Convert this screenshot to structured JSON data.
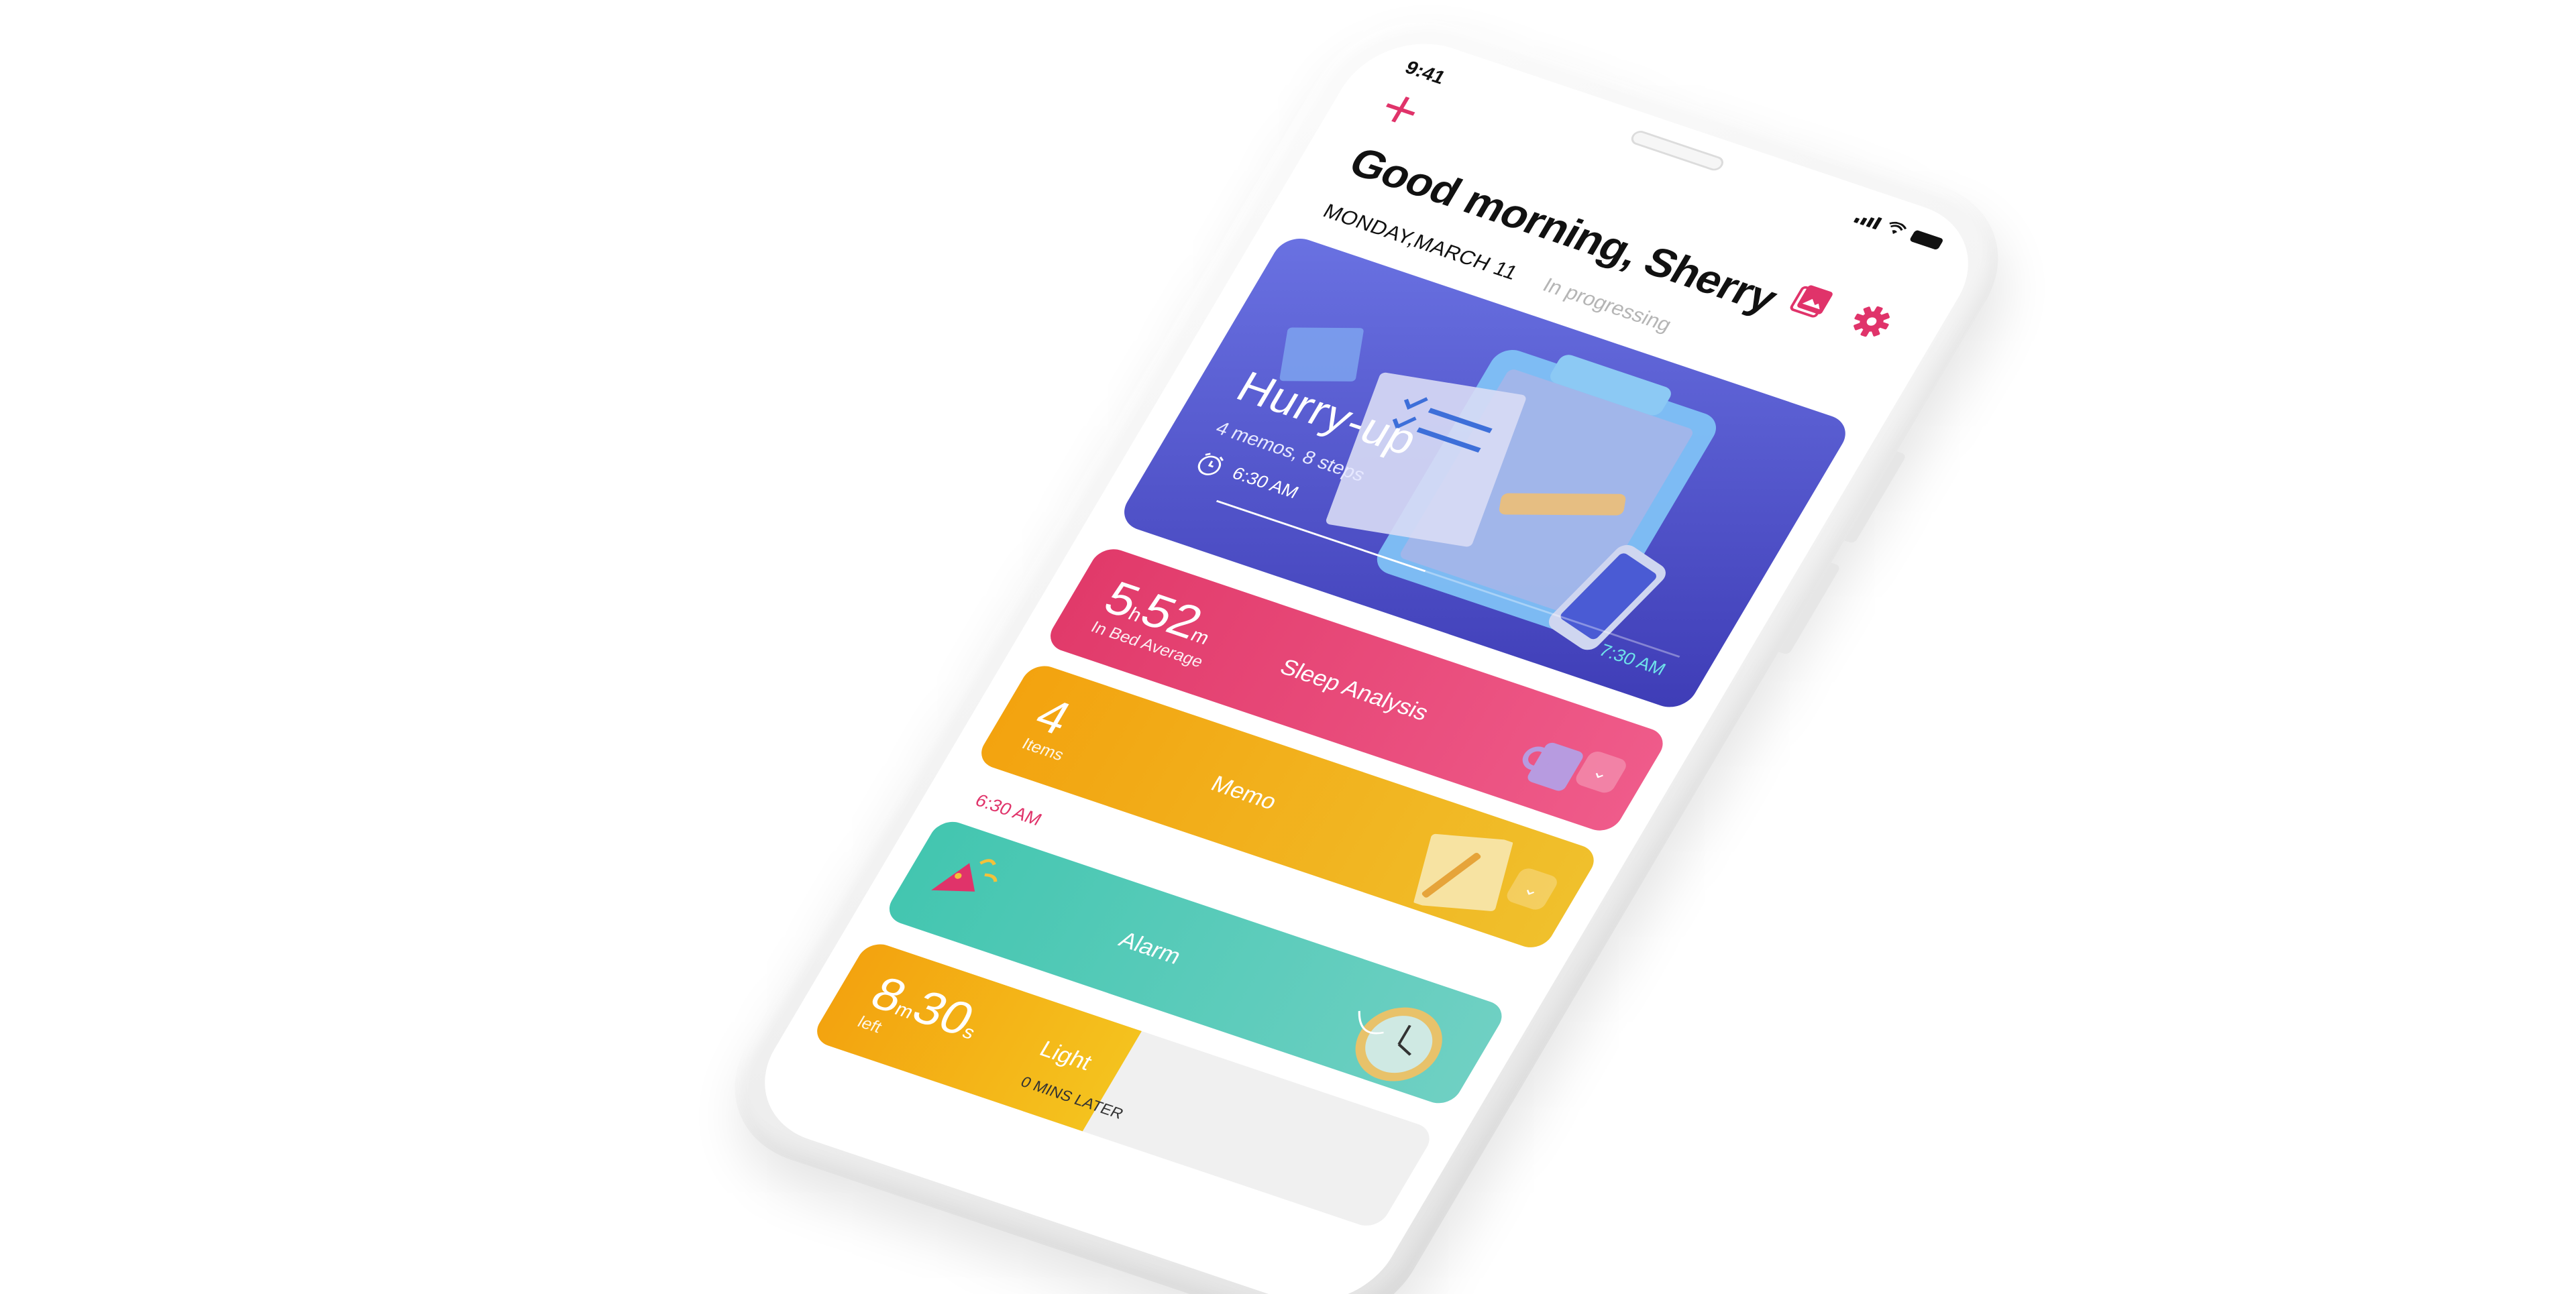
{
  "status_bar": {
    "time": "9:41"
  },
  "header": {
    "greeting": "Good morning,  Sherry",
    "date": "MONDAY,MARCH 11",
    "status": "In progressing",
    "icons": [
      "plus-icon",
      "gallery-icon",
      "gear-icon"
    ]
  },
  "hero": {
    "title": "Hurry-up",
    "subtitle": "4 memos, 8 steps",
    "start_time": "6:30 AM",
    "end_time": "7:30 AM",
    "progress": 0.45
  },
  "cards": {
    "sleep": {
      "hours": "5",
      "hours_unit": "h",
      "minutes": "52",
      "minutes_unit": "m",
      "caption": "In Bed Average",
      "title": "Sleep Analysis"
    },
    "memo": {
      "count": "4",
      "caption": "Items",
      "title": "Memo"
    },
    "alarm": {
      "time_label": "6:30 AM",
      "title": "Alarm"
    },
    "light": {
      "minutes": "8",
      "minutes_unit": "m",
      "seconds": "30",
      "seconds_unit": "s",
      "caption": "left",
      "title": "Light",
      "later": "0 MINS LATER",
      "progress": 0.48
    }
  },
  "colors": {
    "accent": "#e0336a",
    "hero_gradient": [
      "#6a72e2",
      "#3e3cb6"
    ],
    "sleep": "#e13a6a",
    "memo": "#f3a30f",
    "alarm": "#43c6b0"
  }
}
